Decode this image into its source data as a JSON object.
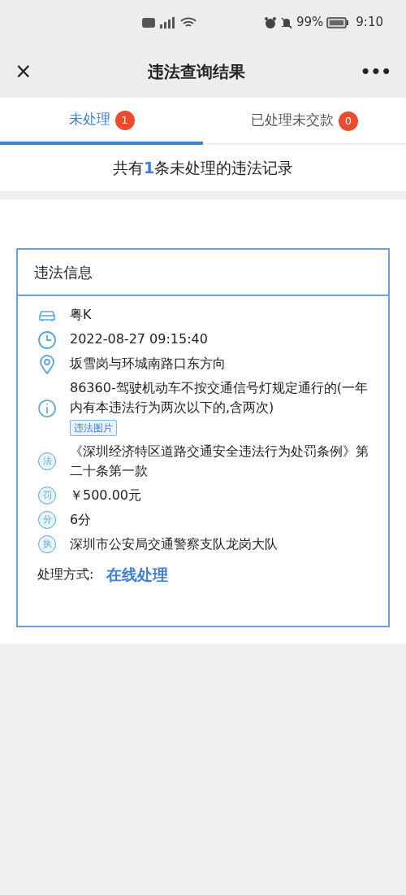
{
  "status_bar": {
    "battery": "99%",
    "time": "9:10"
  },
  "header": {
    "close": "×",
    "title": "违法查询结果",
    "more": "•••"
  },
  "tabs": [
    {
      "label": "未处理",
      "count": "1",
      "selected": true
    },
    {
      "label": "已处理未交款",
      "count": "0",
      "selected": false
    }
  ],
  "summary": "共有**1**条未处理的违法记录",
  "card": {
    "title": "违法信息",
    "rows": [
      {
        "kind": "car",
        "text": "粤K"
      },
      {
        "kind": "clock",
        "text": "2022-08-27 09:15:40"
      },
      {
        "kind": "pin",
        "text": "坂雪岗与环城南路口东方向"
      },
      {
        "kind": "info",
        "text": "86360-驾驶机动车不按交通信号灯规定通行的(一年内有本违法行为两次以下的,含两次)",
        "tag": "违法图片"
      },
      {
        "kind": "seal",
        "seal": "法",
        "text": "《深圳经济特区道路交通安全违法行为处罚条例》第二十条第一款"
      },
      {
        "kind": "seal",
        "seal": "罚",
        "text": "￥500.00元"
      },
      {
        "kind": "seal",
        "seal": "分",
        "text": "6分"
      },
      {
        "kind": "seal",
        "seal": "执",
        "text": "深圳市公安局交通警察支队龙岗大队"
      }
    ],
    "method_label": "处理方式:",
    "method_link": "在线处理"
  }
}
